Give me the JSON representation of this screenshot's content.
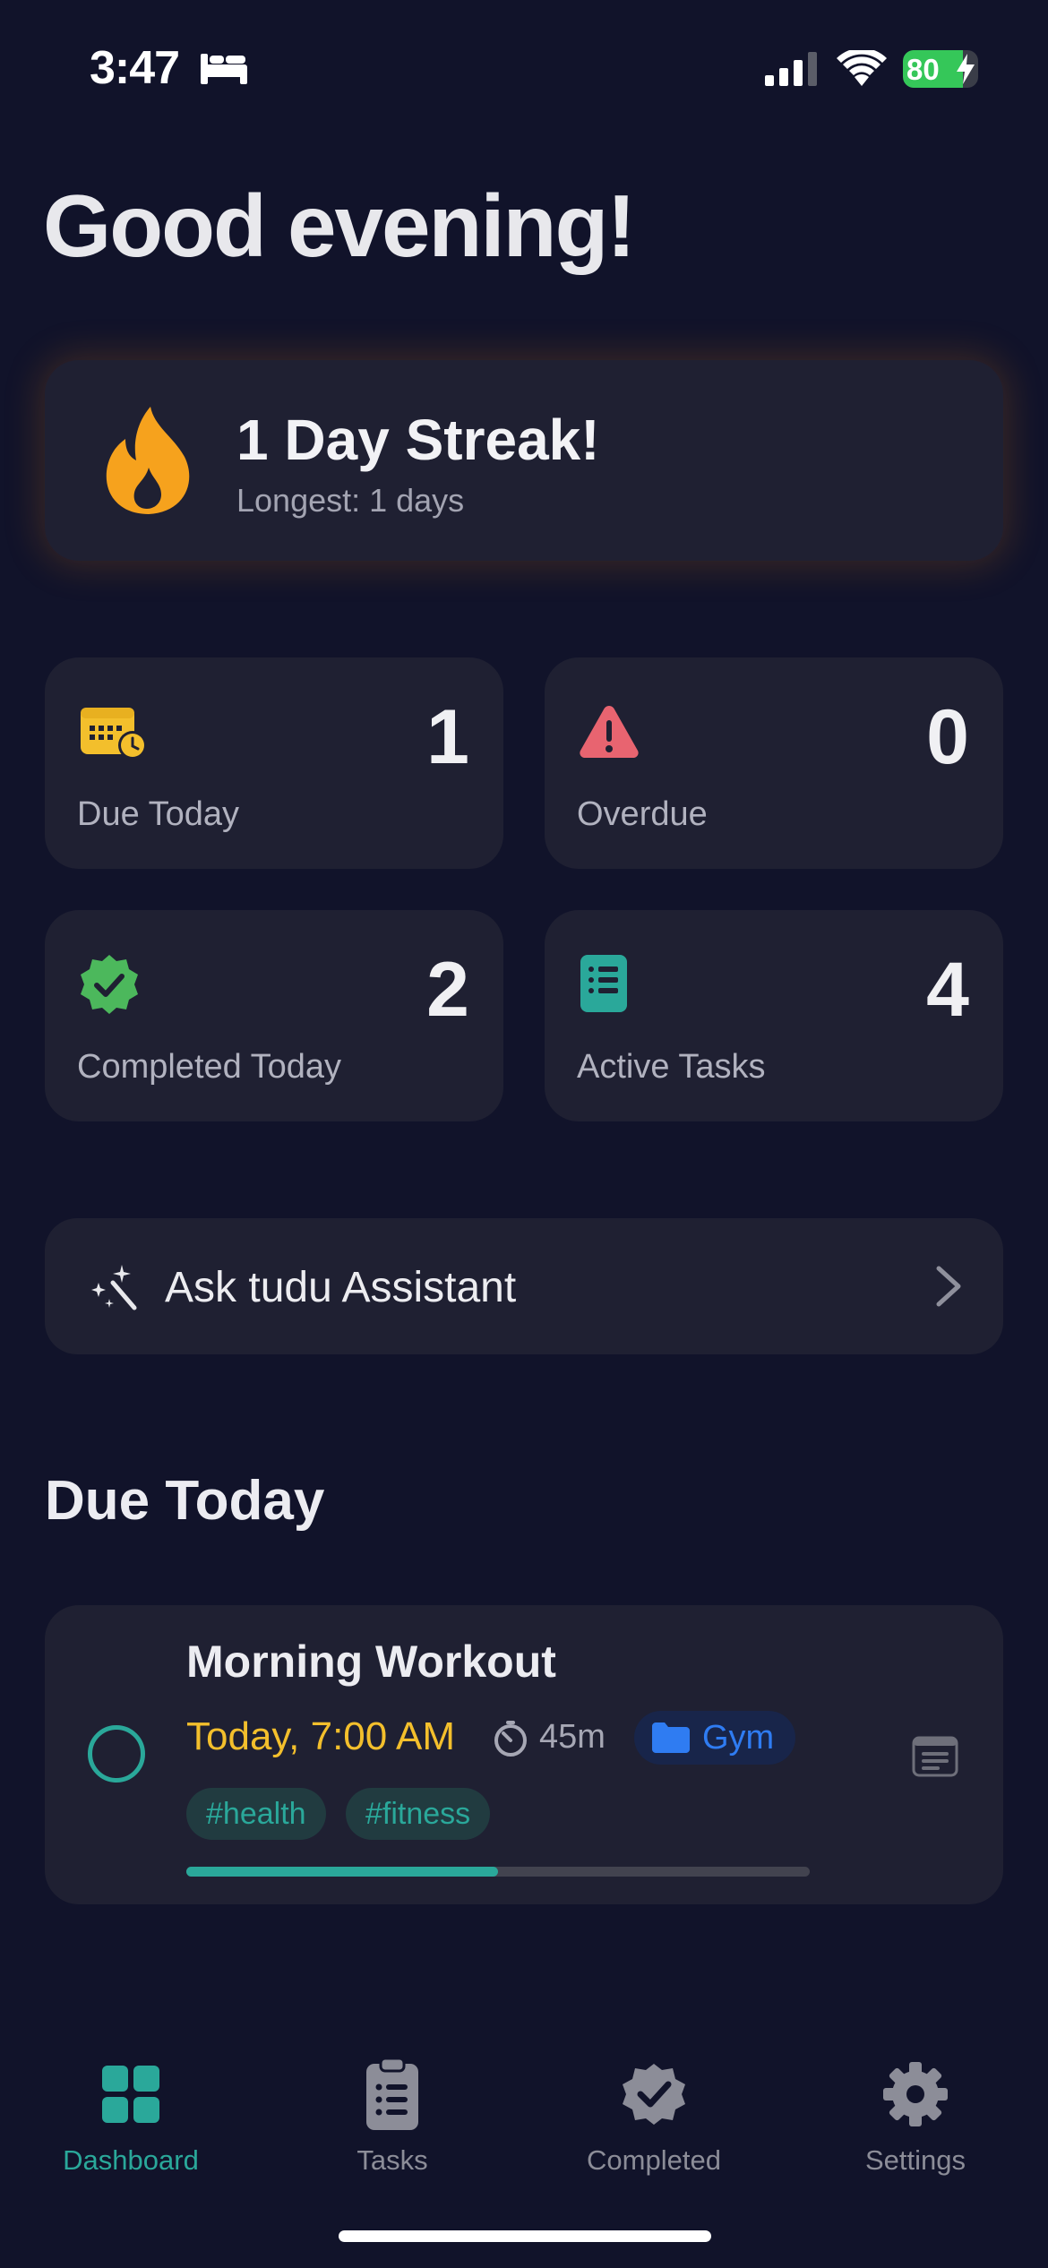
{
  "status_bar": {
    "time": "3:47",
    "battery": "80",
    "battery_level_pct": 80,
    "icons": [
      "bed-icon",
      "signal-icon",
      "wifi-icon",
      "battery-icon"
    ]
  },
  "greeting": "Good evening!",
  "streak": {
    "title": "1 Day Streak!",
    "subtitle": "Longest: 1 days",
    "icon": "flame-icon"
  },
  "stats": [
    {
      "label": "Due Today",
      "count": "1",
      "icon": "calendar-clock-icon",
      "color": "#f3bf2c"
    },
    {
      "label": "Overdue",
      "count": "0",
      "icon": "warning-icon",
      "color": "#e86470"
    },
    {
      "label": "Completed Today",
      "count": "2",
      "icon": "check-badge-icon",
      "color": "#4cb85c"
    },
    {
      "label": "Active Tasks",
      "count": "4",
      "icon": "list-icon",
      "color": "#2aa89a"
    }
  ],
  "assistant": {
    "label": "Ask tudu Assistant"
  },
  "due_section": {
    "title": "Due Today"
  },
  "task": {
    "title": "Morning Workout",
    "due": "Today, 7:00 AM",
    "duration": "45m",
    "folder": "Gym",
    "tags": [
      "#health",
      "#fitness"
    ],
    "progress_pct": 50
  },
  "tabs": [
    {
      "label": "Dashboard",
      "icon": "dashboard-icon",
      "active": true
    },
    {
      "label": "Tasks",
      "icon": "clipboard-icon",
      "active": false
    },
    {
      "label": "Completed",
      "icon": "check-seal-icon",
      "active": false
    },
    {
      "label": "Settings",
      "icon": "gear-icon",
      "active": false
    }
  ],
  "colors": {
    "background": "#11132a",
    "card": "#1f2032",
    "accent": "#2aa89a",
    "due_text": "#f3bf2c",
    "folder_blue": "#2f7cf2"
  }
}
